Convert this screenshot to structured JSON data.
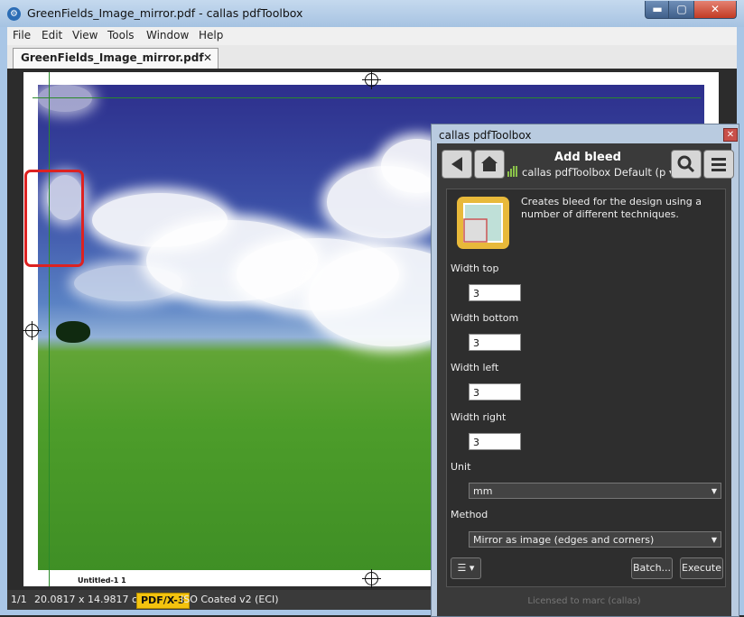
{
  "window": {
    "app_icon": "gear-icon",
    "title": "GreenFields_Image_mirror.pdf - callas pdfToolbox",
    "min_label": "▬",
    "max_label": "▢",
    "close_label": "✕"
  },
  "menu": [
    "File",
    "Edit",
    "View",
    "Tools",
    "Window",
    "Help"
  ],
  "tab": {
    "label": "GreenFields_Image_mirror.pdf",
    "close": "✕"
  },
  "canvas": {
    "slug_text": "Untitled-1   1"
  },
  "status": {
    "page": "1/1",
    "size": "20.0817 x 14.9817 cm",
    "pdfx": "PDF/X-3",
    "profile": "ISO Coated v2 (ECI)"
  },
  "panel": {
    "title": "callas pdfToolbox",
    "close": "✕",
    "heading": "Add bleed",
    "profile": "callas pdfToolbox Default (p",
    "description": "Creates bleed for the design using a number of different techniques.",
    "fields": [
      {
        "label": "Width top",
        "value": "3"
      },
      {
        "label": "Width bottom",
        "value": "3"
      },
      {
        "label": "Width left",
        "value": "3"
      },
      {
        "label": "Width right",
        "value": "3"
      }
    ],
    "unit": {
      "label": "Unit",
      "value": "mm"
    },
    "method": {
      "label": "Method",
      "value": "Mirror as image (edges and corners)"
    },
    "batch_label": "Batch...",
    "execute_label": "Execute",
    "license": "Licensed to marc (callas)"
  },
  "colors": {
    "accent": "#f4c30e",
    "highlight": "#dd2222",
    "guide": "#2a8a2a"
  }
}
